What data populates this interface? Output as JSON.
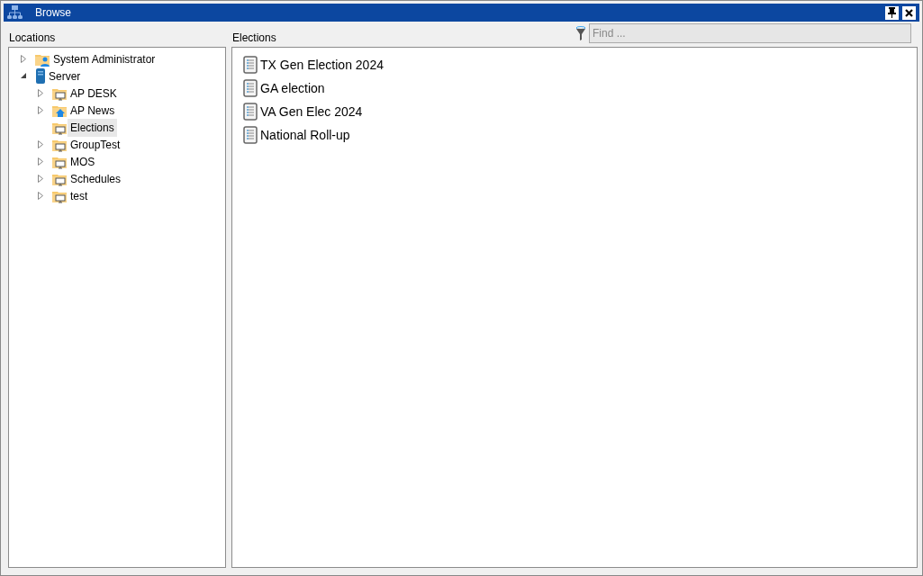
{
  "window": {
    "title": "Browse"
  },
  "locations": {
    "label": "Locations",
    "tree": [
      {
        "label": "System Administrator",
        "kind": "user-folder",
        "expanded": false,
        "selected": false
      },
      {
        "label": "Server",
        "kind": "server",
        "expanded": true,
        "selected": false,
        "children": [
          {
            "label": "AP DESK",
            "kind": "monitor-folder",
            "expanded": false,
            "selected": false
          },
          {
            "label": "AP News",
            "kind": "home-folder",
            "expanded": false,
            "selected": false
          },
          {
            "label": "Elections",
            "kind": "monitor-folder",
            "selected": true
          },
          {
            "label": "GroupTest",
            "kind": "monitor-folder",
            "expanded": false,
            "selected": false
          },
          {
            "label": "MOS",
            "kind": "monitor-folder",
            "expanded": false,
            "selected": false
          },
          {
            "label": "Schedules",
            "kind": "monitor-folder",
            "expanded": false,
            "selected": false
          },
          {
            "label": "test",
            "kind": "monitor-folder",
            "expanded": false,
            "selected": false
          }
        ]
      }
    ]
  },
  "elections": {
    "label": "Elections",
    "search": {
      "placeholder": "Find ..."
    },
    "items": [
      {
        "label": "TX Gen Election 2024"
      },
      {
        "label": "GA election"
      },
      {
        "label": "VA Gen Elec 2024"
      },
      {
        "label": "National Roll-up"
      }
    ]
  }
}
